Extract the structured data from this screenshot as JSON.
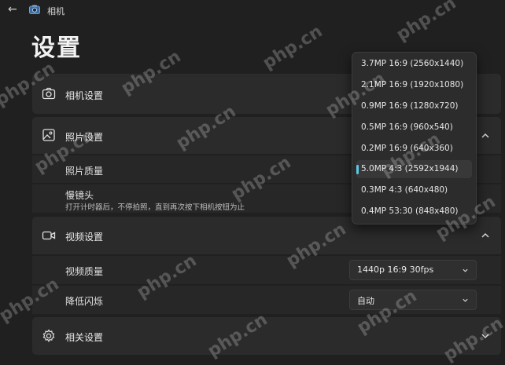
{
  "app": {
    "title": "相机",
    "page_title": "设置"
  },
  "sections": {
    "camera": {
      "label": "相机设置"
    },
    "photo": {
      "label": "照片设置",
      "quality_label": "照片质量",
      "timelapse_label": "慢镜头",
      "timelapse_desc": "打开计时器后，不停拍照，直到再次按下相机按钮为止"
    },
    "video": {
      "label": "视频设置",
      "quality_label": "视频质量",
      "quality_value": "1440p 16:9 30fps",
      "flicker_label": "降低闪烁",
      "flicker_value": "自动"
    },
    "related": {
      "label": "相关设置"
    }
  },
  "flyout": {
    "options": [
      "3.7MP 16:9 (2560x1440)",
      "2.1MP 16:9 (1920x1080)",
      "0.9MP 16:9 (1280x720)",
      "0.5MP 16:9 (960x540)",
      "0.2MP 16:9 (640x360)",
      "5.0MP 4:3 (2592x1944)",
      "0.3MP 4:3 (640x480)",
      "0.4MP 53:30 (848x480)"
    ],
    "selected_index": 5
  },
  "watermark": "php.cn",
  "colors": {
    "accent": "#5cc8e8",
    "background": "#202020",
    "card": "#2b2b2b"
  }
}
